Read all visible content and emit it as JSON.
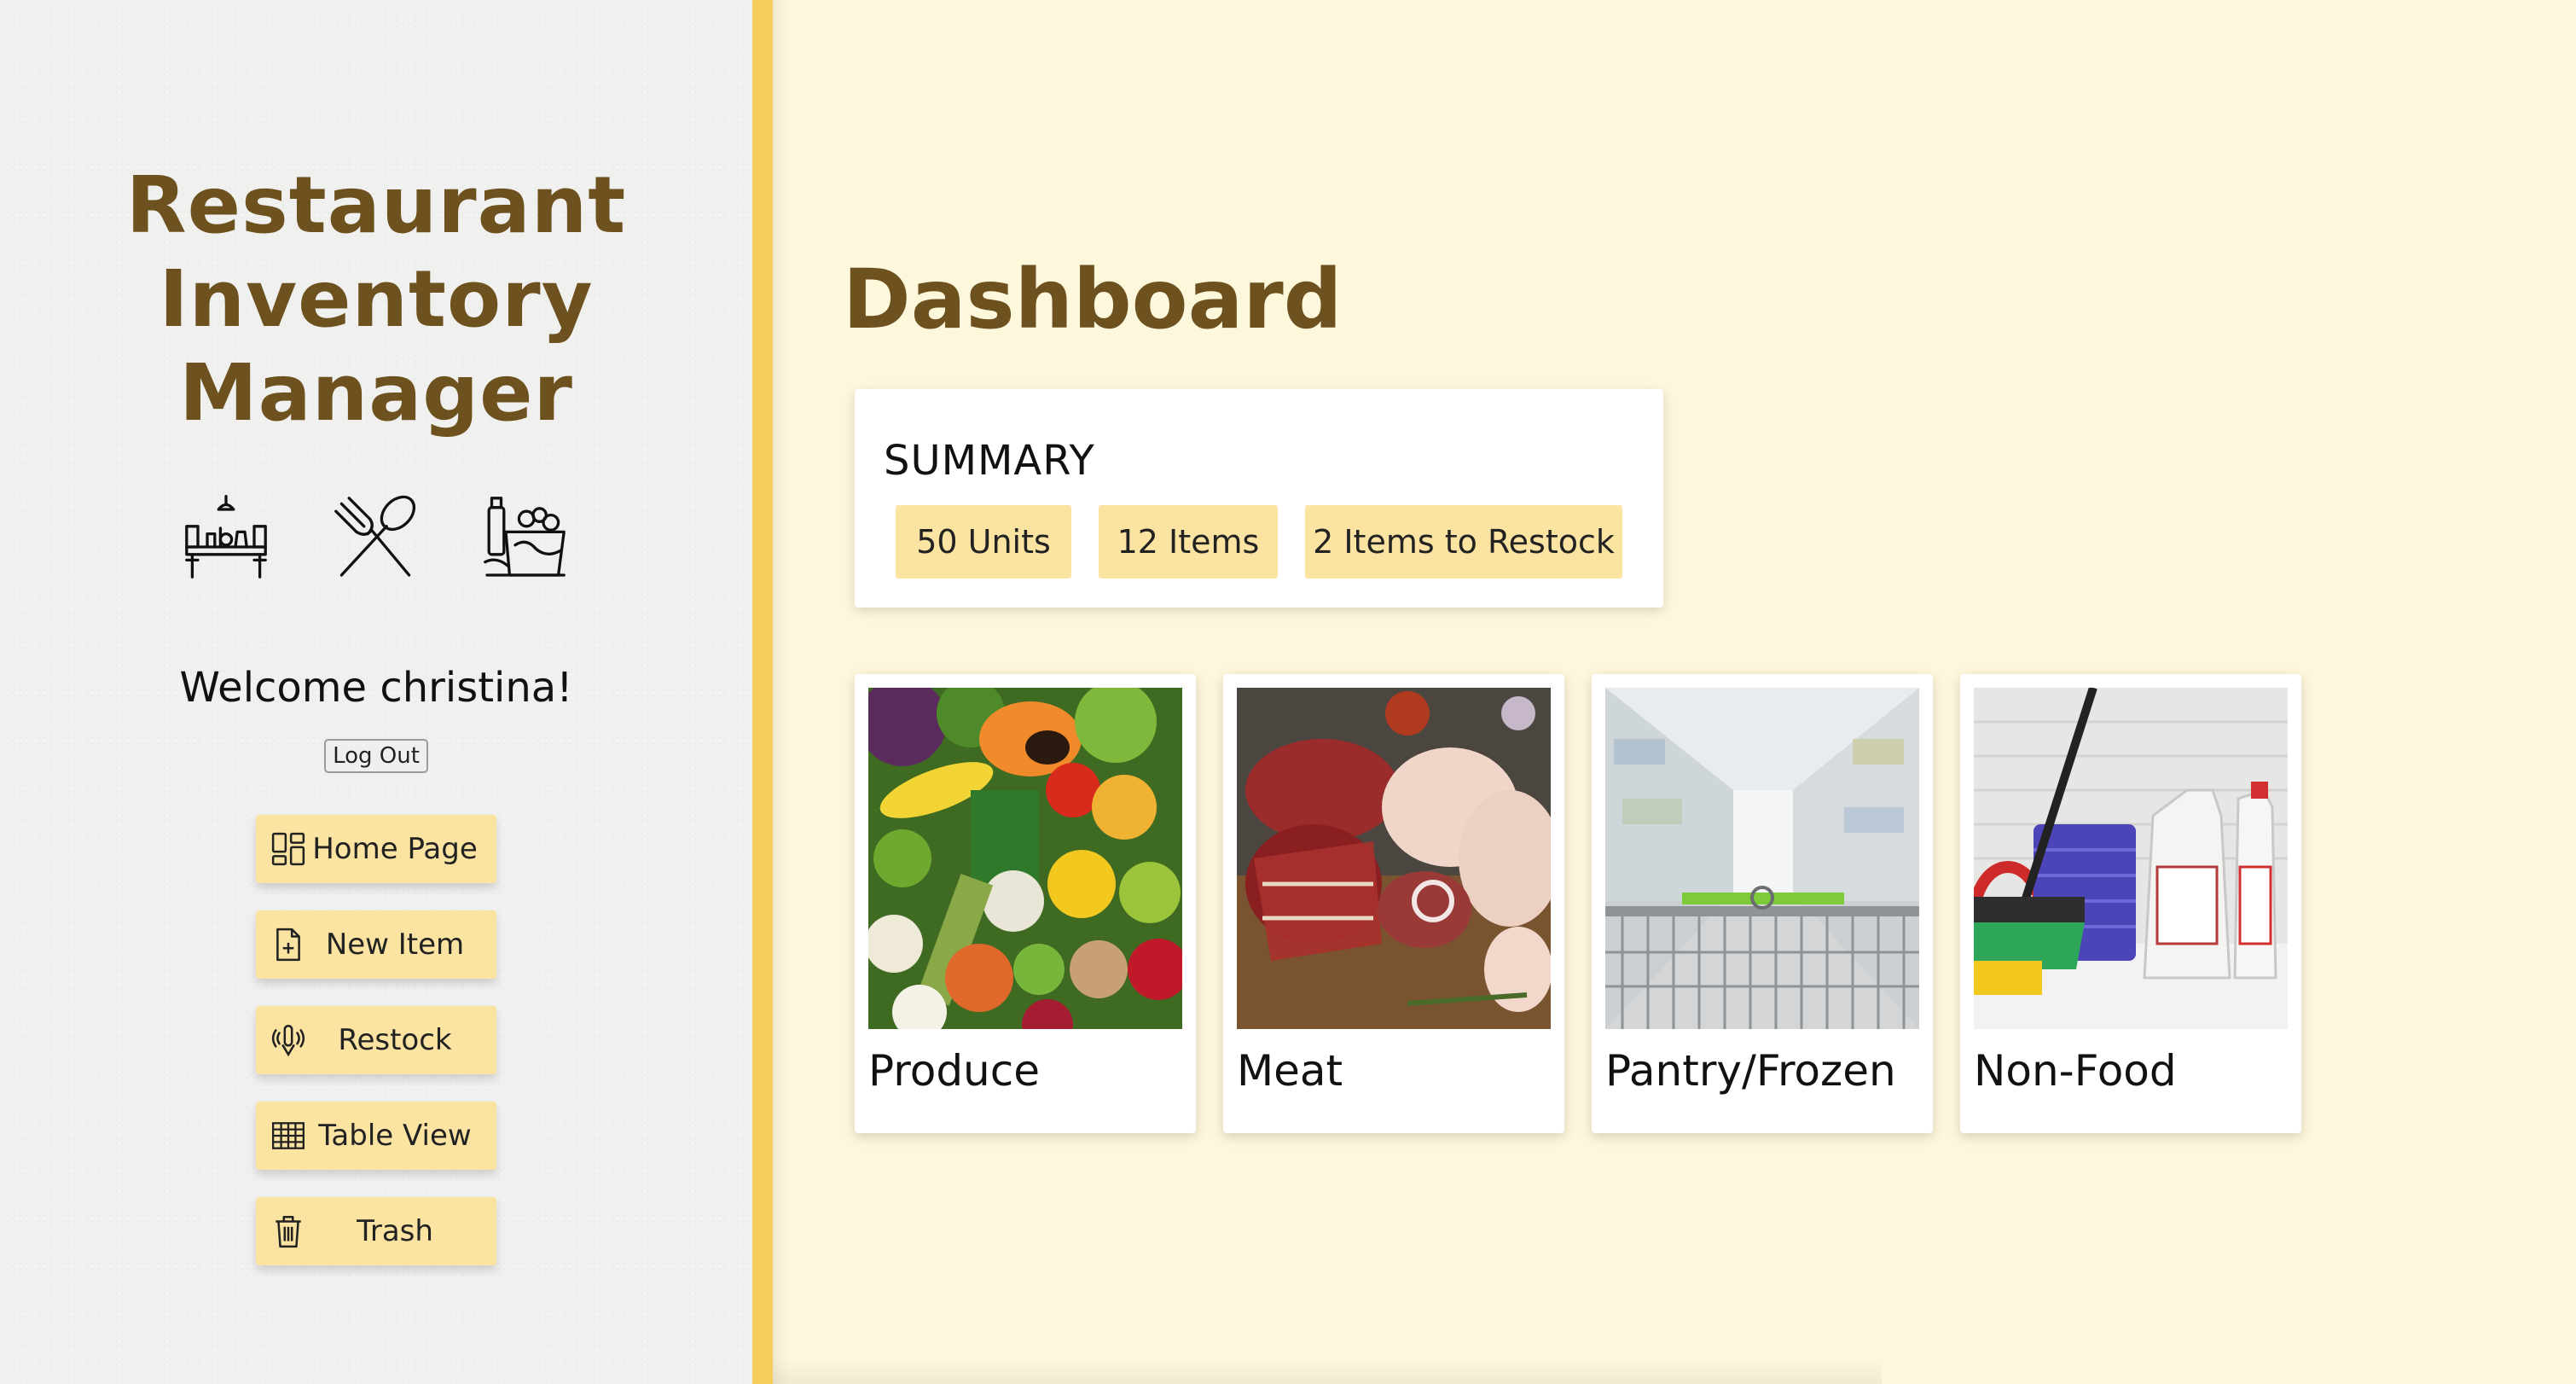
{
  "sidebar": {
    "title_lines": [
      "Restaurant",
      "Inventory",
      "Manager"
    ],
    "hero_icons": [
      "restaurant-table-icon",
      "fork-spoon-icon",
      "groceries-icon"
    ],
    "welcome": "Welcome christina!",
    "logout_label": "Log Out",
    "nav": [
      {
        "label": "Home Page",
        "icon": "dashboard-icon"
      },
      {
        "label": "New Item",
        "icon": "add-file-icon"
      },
      {
        "label": "Restock",
        "icon": "restock-icon"
      },
      {
        "label": "Table View",
        "icon": "table-icon"
      },
      {
        "label": "Trash",
        "icon": "trash-icon"
      }
    ]
  },
  "main": {
    "title": "Dashboard",
    "summary": {
      "title": "SUMMARY",
      "badges": [
        "50 Units",
        "12 Items",
        "2 Items to Restock"
      ]
    },
    "categories": [
      {
        "label": "Produce"
      },
      {
        "label": "Meat"
      },
      {
        "label": "Pantry/Frozen"
      },
      {
        "label": "Non-Food"
      }
    ]
  },
  "colors": {
    "accent": "#f5cd5a",
    "button": "#fbe3a1",
    "title": "#6d511f",
    "main_bg": "#fdf7dc",
    "sidebar_bg": "#f0f0ee"
  }
}
